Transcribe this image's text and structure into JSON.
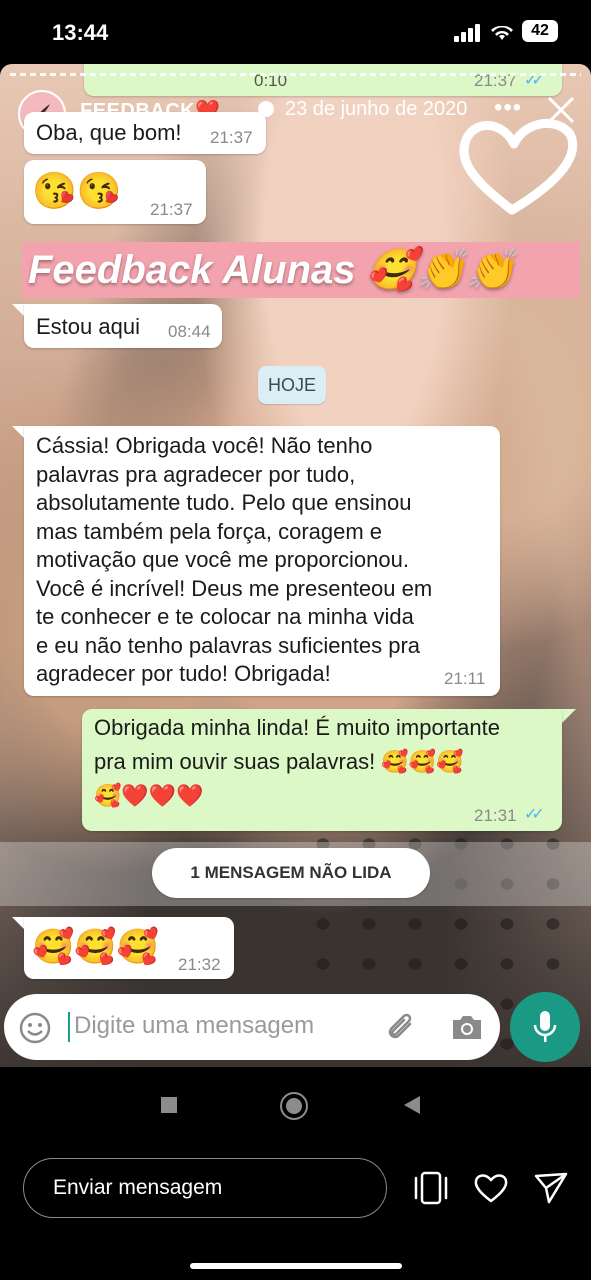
{
  "status_bar": {
    "time": "13:44",
    "battery": "42"
  },
  "story": {
    "account": "FEEDBACK❤️ ...",
    "date": "23 de junho de 2020",
    "more": "•••",
    "title": "Feedback Alunas 🥰👏👏"
  },
  "chat": {
    "audio": {
      "duration": "0:10",
      "time": "21:37"
    },
    "messages": [
      {
        "text": "Oba, que bom!",
        "time": "21:37",
        "dir": "in"
      },
      {
        "text": "😘😘",
        "time": "21:37",
        "dir": "in"
      },
      {
        "text": "Estou aqui",
        "time": "08:44",
        "dir": "in"
      },
      {
        "lines": [
          "Cássia! Obrigada você! Não tenho",
          "palavras pra agradecer por tudo,",
          "absolutamente tudo. Pelo que ensinou",
          "mas também pela força, coragem e",
          "motivação que você me proporcionou.",
          "Você é incrível! Deus me presenteou em",
          "te conhecer e te colocar na minha vida",
          "e eu não tenho palavras suficientes pra",
          "agradecer por tudo! Obrigada!"
        ],
        "time": "21:11",
        "dir": "in"
      },
      {
        "lines": [
          "Obrigada minha linda! É muito importante",
          "pra mim ouvir suas palavras! 🥰🥰🥰",
          "🥰❤️❤️❤️"
        ],
        "time": "21:31",
        "dir": "out"
      },
      {
        "text": "🥰🥰🥰",
        "time": "21:32",
        "dir": "in"
      }
    ],
    "date_chip": "HOJE",
    "unread": "1 MENSAGEM NÃO LIDA",
    "input_placeholder": "Digite uma mensagem"
  },
  "reply_bar": {
    "placeholder": "Enviar mensagem"
  },
  "colors": {
    "out_bubble": "#dcf8c6",
    "in_bubble": "#ffffff",
    "read_ticks": "#4fb6ec",
    "mic": "#1a9a84",
    "banner": "#f2a3ad"
  },
  "icons": [
    "signal-icon",
    "wifi-icon",
    "battery-icon",
    "verified-icon",
    "more-icon",
    "close-icon",
    "heart-outline-sticker",
    "emoji-icon",
    "attach-icon",
    "camera-icon",
    "mic-icon",
    "nav-square-icon",
    "nav-home-icon",
    "nav-back-icon",
    "carousel-icon",
    "like-heart-icon",
    "send-icon"
  ]
}
